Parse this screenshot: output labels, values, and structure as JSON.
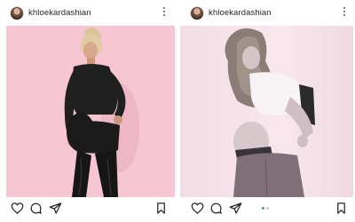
{
  "posts": [
    {
      "username": "khloekardashian",
      "icons": [
        "avatar",
        "more-icon",
        "heart-icon",
        "comment-icon",
        "share-icon",
        "bookmark-icon"
      ],
      "photo": {
        "background": "#f6c6d3"
      }
    },
    {
      "username": "khloekardashian",
      "icons": [
        "avatar",
        "more-icon",
        "heart-icon",
        "comment-icon",
        "share-icon",
        "bookmark-icon"
      ],
      "photo": {
        "background": "#f3dde4"
      },
      "carousel": {
        "slides": 2,
        "active": 1,
        "active_color": "#3897f0",
        "inactive_color": "#c7c7c7"
      }
    }
  ]
}
